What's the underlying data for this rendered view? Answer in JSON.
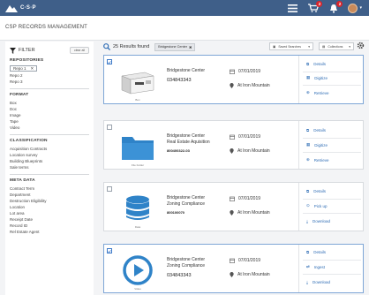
{
  "app": {
    "name": "C·S·P"
  },
  "topbar": {
    "cart_badge": "2",
    "bell_badge": "2"
  },
  "page": {
    "title": "CSP RECORDS MANAGEMENT"
  },
  "sidebar": {
    "filter_title": "FILTER",
    "clear_label": "clear all",
    "repositories": {
      "heading": "REPOSITORIES",
      "selected": "Repo 1",
      "items": [
        "Repo 2",
        "Repo 3"
      ]
    },
    "format": {
      "heading": "FORMAT",
      "items": [
        "Box",
        "Doc",
        "Image",
        "Tape",
        "Video"
      ]
    },
    "classification": {
      "heading": "CLASSIFICATION",
      "items": [
        "Acquisition Contracts",
        "Location survey",
        "Building Blueprints",
        "Sale terms"
      ]
    },
    "metadata": {
      "heading": "META DATA",
      "items": [
        "Contract Term",
        "Department",
        "Destruction Eligibility",
        "Location",
        "Lot area",
        "Receipt Date",
        "Record ID",
        "Rel Estate Agent"
      ]
    }
  },
  "results": {
    "count_text": "25 Results found",
    "chip": "Bridgestone Center",
    "sort_label": "Saved Searches",
    "view_label": "Collections"
  },
  "cards": [
    {
      "type": "box",
      "thumb_caption": "Box",
      "name": [
        "Bridgestone Center"
      ],
      "barcode": "034843343",
      "barcode_small": false,
      "date": "07/01/2019",
      "location": "At Iron Mountain",
      "actions": [
        {
          "label": "Details",
          "icon": "details-icon"
        },
        {
          "label": "Digitize",
          "icon": "digitize-icon"
        },
        {
          "label": "Retrieve",
          "icon": "retrieve-icon"
        }
      ]
    },
    {
      "type": "folder",
      "thumb_caption": "File Folder",
      "name": [
        "Bridgestone Center",
        "Real Estate Aquisition"
      ],
      "barcode": "800400322-03",
      "barcode_small": true,
      "date": "07/01/2019",
      "location": "At Iron Mountain",
      "actions": [
        {
          "label": "Details",
          "icon": "details-icon"
        },
        {
          "label": "Digitize",
          "icon": "digitize-icon"
        },
        {
          "label": "Retrieve",
          "icon": "retrieve-icon"
        }
      ]
    },
    {
      "type": "disk",
      "thumb_caption": "Data",
      "name": [
        "Bridgestone Center",
        "Zoning Compliance"
      ],
      "barcode": "800100070",
      "barcode_small": true,
      "date": "07/01/2019",
      "location": "At Iron Mountain",
      "actions": [
        {
          "label": "Details",
          "icon": "details-icon"
        },
        {
          "label": "Pick up",
          "icon": "pickup-icon"
        },
        {
          "label": "Download",
          "icon": "download-icon"
        }
      ]
    },
    {
      "type": "video",
      "thumb_caption": "Video",
      "name": [
        "Bridgestone Center",
        "Zoning Compliance"
      ],
      "barcode": "034843343",
      "barcode_small": false,
      "date": "07/01/2019",
      "location": "At Iron Mountain",
      "actions": [
        {
          "label": "Details",
          "icon": "details-icon"
        },
        {
          "label": "Ingest",
          "icon": "ingest-icon"
        },
        {
          "label": "Download",
          "icon": "download-icon"
        }
      ]
    }
  ],
  "colors": {
    "topbar": "#3f5f89",
    "accent": "#2f6db5",
    "badge": "#d9262c"
  }
}
